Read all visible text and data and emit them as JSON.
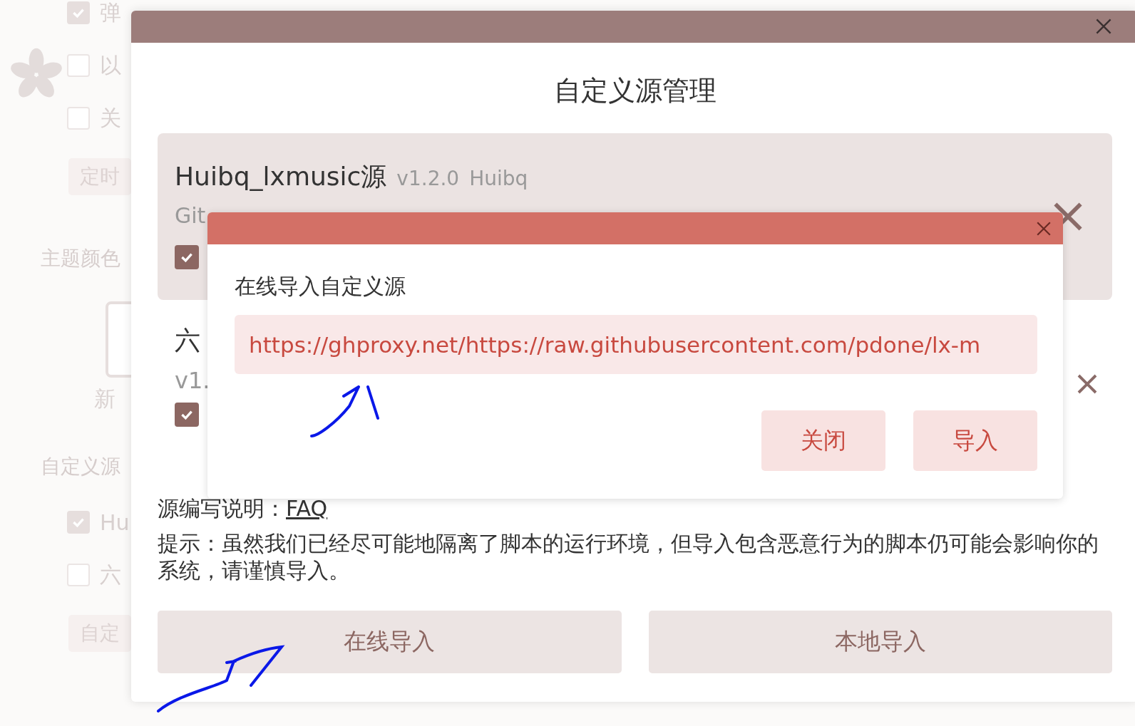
{
  "background_settings": {
    "items": [
      {
        "kind": "checkbox",
        "label": "弹",
        "checked": true
      },
      {
        "kind": "checkbox",
        "label": "以",
        "checked": false
      },
      {
        "kind": "checkbox",
        "label": "关",
        "checked": false
      },
      {
        "kind": "button",
        "label": "定时"
      },
      {
        "kind": "heading",
        "label": "主题颜色"
      },
      {
        "kind": "theme",
        "label": "新"
      },
      {
        "kind": "heading",
        "label": "自定义源"
      },
      {
        "kind": "checkbox",
        "label": "Hu",
        "checked": true
      },
      {
        "kind": "checkbox",
        "label": "六",
        "checked": false
      },
      {
        "kind": "button",
        "label": "自定"
      }
    ]
  },
  "dialog": {
    "title": "自定义源管理",
    "sources": [
      {
        "name": "Huibq_lxmusic源",
        "version": "v1.2.0",
        "author": "Huibq",
        "description": "Git",
        "enabled": true,
        "selected": true
      },
      {
        "name": "六",
        "version": "v1.",
        "enabled": true,
        "selected": false
      }
    ],
    "note_label": "源编写说明：",
    "note_link": "FAQ",
    "hint": "提示：虽然我们已经尽可能地隔离了脚本的运行环境，但导入包含恶意行为的脚本仍可能会影响你的系统，请谨慎导入。",
    "buttons": [
      "在线导入",
      "本地导入"
    ]
  },
  "import_dialog": {
    "title": "在线导入自定义源",
    "value": "https://ghproxy.net/https://raw.githubusercontent.com/pdone/lx-m",
    "buttons": [
      "关闭",
      "导入"
    ]
  }
}
